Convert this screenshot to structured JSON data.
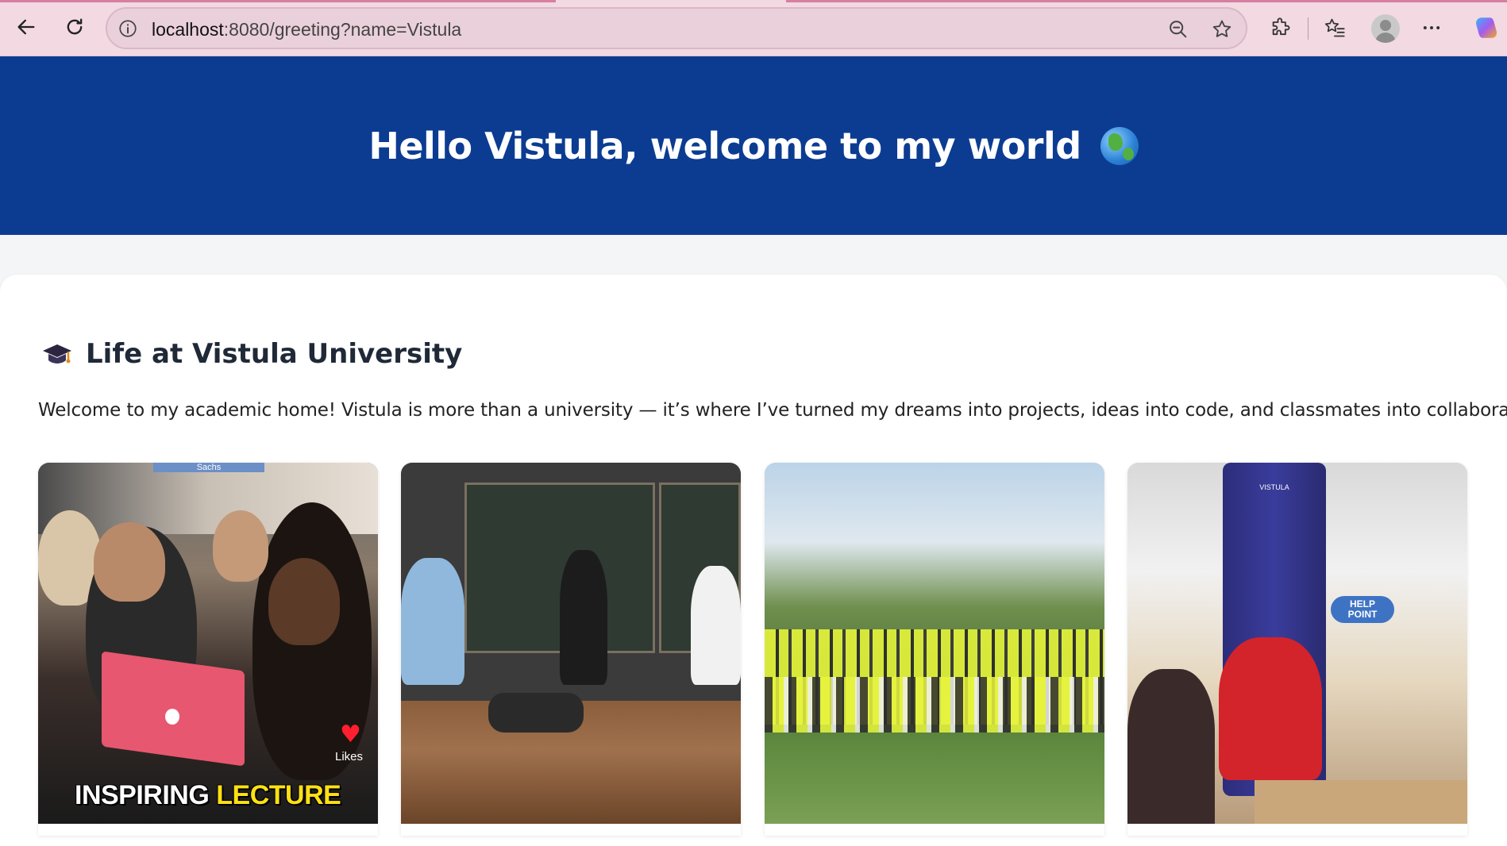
{
  "browser": {
    "url_host": "localhost",
    "url_path": ":8080/greeting?name=Vistula"
  },
  "hero": {
    "title": "Hello Vistula, welcome to my world"
  },
  "section": {
    "title": "Life at Vistula University",
    "intro": "Welcome to my academic home! Vistula is more than a university — it’s where I’ve turned my dreams into projects, ideas into code, and classmates into collaborators."
  },
  "gallery": {
    "photo1": {
      "sign_text": "Sachs",
      "likes_label": "Likes",
      "caption_white": "INSPIRING ",
      "caption_yellow": "LECTURE"
    },
    "photo4": {
      "help_text_1": "HELP",
      "help_text_2": "POINT",
      "pillar_text": "VISTULA"
    }
  },
  "colors": {
    "hero_bg": "#0c3c92",
    "browser_bar": "#f2d9e2",
    "caption_highlight": "#ffe014",
    "heart": "#ff1f2e"
  }
}
